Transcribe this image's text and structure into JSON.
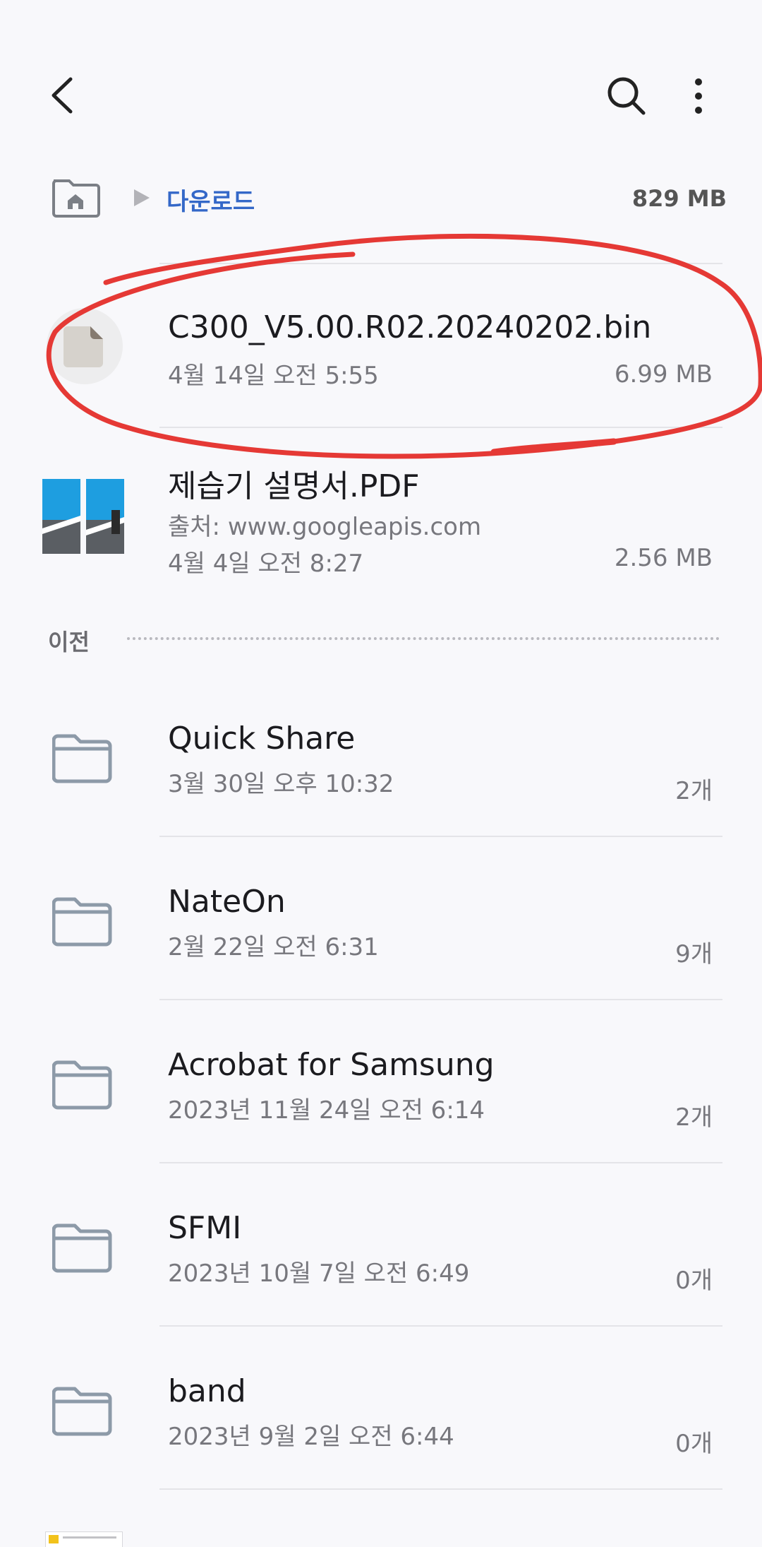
{
  "toolbar": {
    "back_icon": "back-arrow-icon",
    "search_icon": "search-icon",
    "more_icon": "more-vert-icon"
  },
  "breadcrumb": {
    "home_icon": "home-folder-icon",
    "separator_icon": "triangle-right-icon",
    "current": "다운로드",
    "total_size": "829 MB"
  },
  "files": [
    {
      "name": "C300_V5.00.R02.20240202.bin",
      "date": "4월 14일 오전 5:55",
      "size": "6.99 MB",
      "icon": "generic-file-icon"
    },
    {
      "name": "제습기 설명서.PDF",
      "source": "출처: www.googleapis.com",
      "date": "4월 4일 오전 8:27",
      "size": "2.56 MB",
      "icon": "pdf-thumbnail"
    }
  ],
  "section": {
    "label": "이전"
  },
  "folders": [
    {
      "name": "Quick Share",
      "date": "3월 30일 오후 10:32",
      "count": "2개"
    },
    {
      "name": "NateOn",
      "date": "2월 22일 오전 6:31",
      "count": "9개"
    },
    {
      "name": "Acrobat for Samsung",
      "date": "2023년 11월 24일 오전 6:14",
      "count": "2개"
    },
    {
      "name": "SFMI",
      "date": "2023년 10월 7일 오전 6:49",
      "count": "0개"
    },
    {
      "name": "band",
      "date": "2023년 9월 2일 오전 6:44",
      "count": "0개"
    }
  ],
  "colors": {
    "accent": "#3468c8",
    "annotation_red": "#e53935",
    "folder_stroke": "#8d9aa8"
  }
}
